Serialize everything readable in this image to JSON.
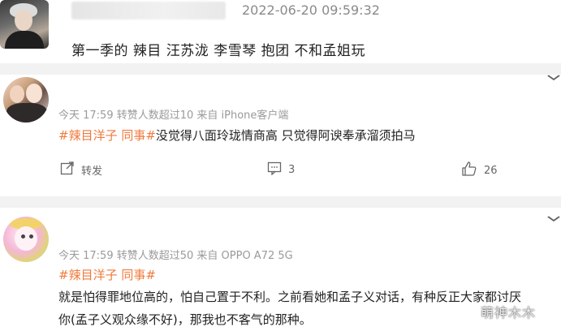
{
  "top_comment": {
    "timestamp": "2022-06-20 09:59:32",
    "text": "第一季的 辣目 汪苏泷 李雪琴 抱团 不和孟姐玩"
  },
  "comments": [
    {
      "meta": "今天 17:59 转赞人数超过10 来自 iPhone客户端",
      "hashtag": "#辣目洋子 同事#",
      "text": "没觉得八面玲珑情商高 只觉得阿谀奉承溜须拍马",
      "actions": {
        "repost_label": "转发",
        "comment_count": "3",
        "like_count": "26"
      }
    },
    {
      "meta": "今天 17:59 转赞人数超过50 来自 OPPO A72 5G",
      "hashtag": "#辣目洋子 同事#",
      "text_line1": "就是怕得罪地位高的，怕自己置于不利。之前看她和孟子义对话，有种反正大家都讨厌",
      "text_line2": "你(孟子义观众缘不好)，那我也不客气的那种。"
    }
  ],
  "watermark": "萌神木木",
  "colors": {
    "hashtag": "#f07a3c",
    "meta": "#9a9a9a",
    "divider": "#f2f2f2"
  },
  "icons": [
    "repost-icon",
    "comment-icon",
    "like-icon",
    "chevron-down-icon"
  ]
}
